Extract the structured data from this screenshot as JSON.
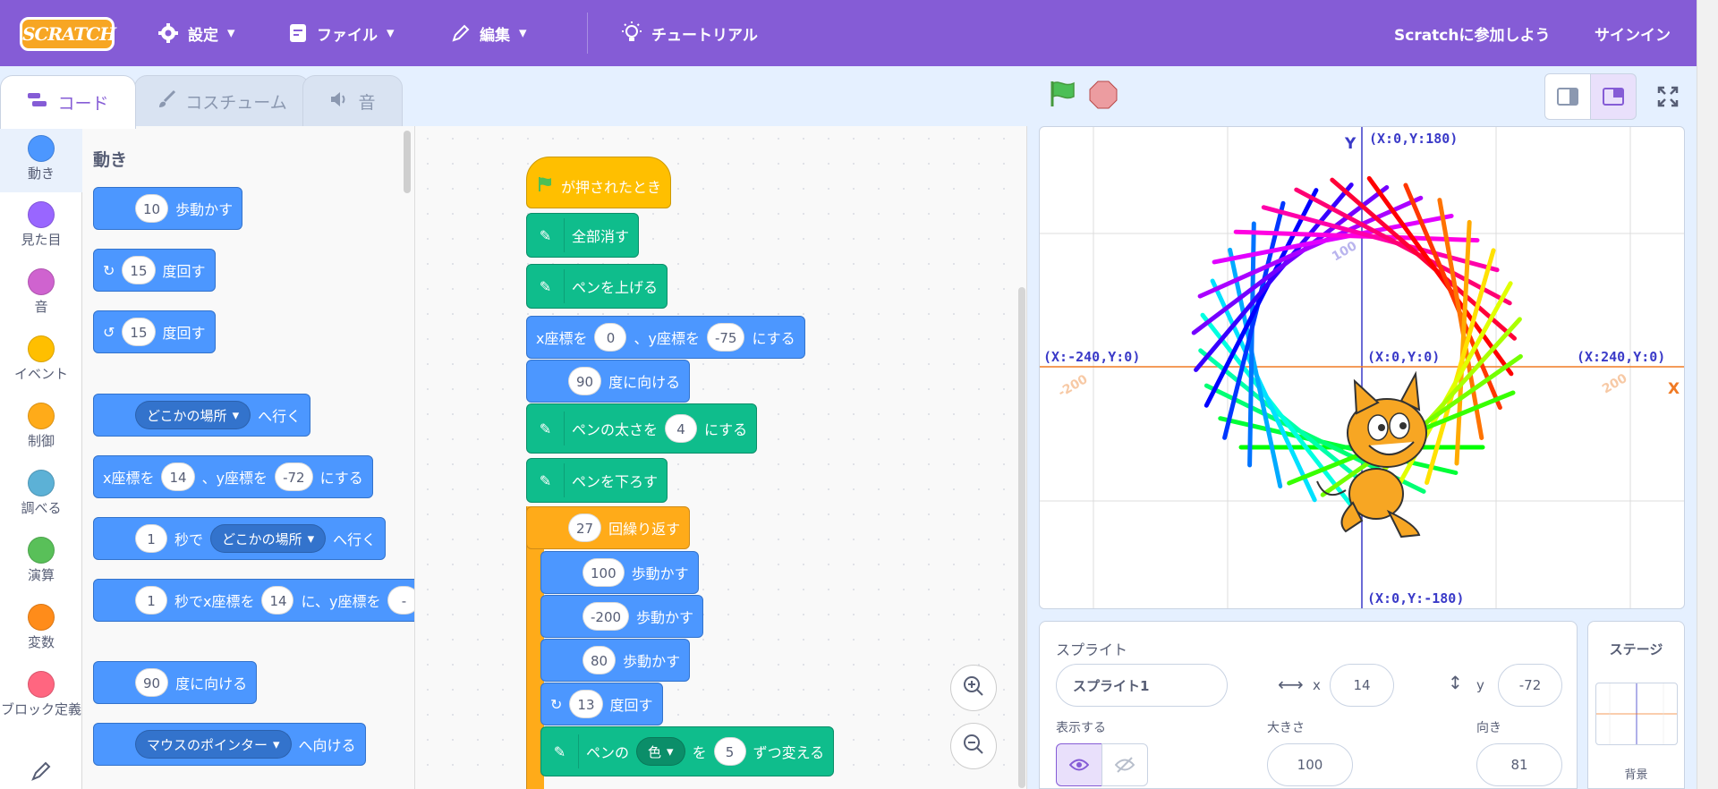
{
  "menubar": {
    "logo": "SCRATCH",
    "settings": "設定",
    "file": "ファイル",
    "edit": "編集",
    "tutorial": "チュートリアル",
    "join": "Scratchに参加しよう",
    "signin": "サインイン"
  },
  "tabs": {
    "code": "コード",
    "costume": "コスチューム",
    "sound": "音"
  },
  "categories": [
    {
      "label": "動き",
      "color": "#4c97ff"
    },
    {
      "label": "見た目",
      "color": "#9966ff"
    },
    {
      "label": "音",
      "color": "#cf63cf"
    },
    {
      "label": "イベント",
      "color": "#ffbf00"
    },
    {
      "label": "制御",
      "color": "#ffab19"
    },
    {
      "label": "調べる",
      "color": "#5cb1d6"
    },
    {
      "label": "演算",
      "color": "#59c059"
    },
    {
      "label": "変数",
      "color": "#ff8c1a"
    },
    {
      "label": "ブロック定義",
      "color": "#ff6680"
    }
  ],
  "palette": {
    "heading": "動き",
    "move": {
      "value": "10",
      "text": "歩動かす"
    },
    "turn_right": {
      "value": "15",
      "text": "度回す"
    },
    "turn_left": {
      "value": "15",
      "text": "度回す"
    },
    "goto": {
      "drop": "どこかの場所",
      "text": "へ行く"
    },
    "goto_xy": {
      "a": "x座標を",
      "x": "14",
      "b": "、y座標を",
      "y": "-72",
      "c": "にする"
    },
    "glide": {
      "value": "1",
      "a": "秒で",
      "drop": "どこかの場所",
      "b": "へ行く"
    },
    "glide_xy": {
      "value": "1",
      "a": "秒でx座標を",
      "x": "14",
      "b": "に、y座標を",
      "y": "-"
    },
    "point": {
      "value": "90",
      "text": "度に向ける"
    },
    "point_towards": {
      "drop": "マウスのポインター",
      "text": "へ向ける"
    }
  },
  "script": {
    "flag": "が押されたとき",
    "clear": "全部消す",
    "pen_up": "ペンを上げる",
    "goto": {
      "a": "x座標を",
      "x": "0",
      "b": "、y座標を",
      "y": "-75",
      "c": "にする"
    },
    "point": {
      "value": "90",
      "text": "度に向ける"
    },
    "pen_size": {
      "a": "ペンの太さを",
      "value": "4",
      "b": "にする"
    },
    "pen_down": "ペンを下ろす",
    "repeat": {
      "value": "27",
      "text": "回繰り返す"
    },
    "move1": {
      "value": "100",
      "text": "歩動かす"
    },
    "move2": {
      "value": "-200",
      "text": "歩動かす"
    },
    "move3": {
      "value": "80",
      "text": "歩動かす"
    },
    "turn": {
      "value": "13",
      "text": "度回す"
    },
    "pen_color": {
      "a": "ペンの",
      "drop": "色",
      "b": "を",
      "value": "5",
      "c": "ずつ変える"
    }
  },
  "stage": {
    "labels": {
      "top": "(X:0,Y:180)",
      "bottom": "(X:0,Y:-180)",
      "left": "(X:-240,Y:0)",
      "right": "(X:240,Y:0)",
      "center": "(X:0,Y:0)",
      "y_axis": "Y",
      "x_axis": "X",
      "tick100": "100",
      "tick200": "200",
      "tickm200": "-200"
    }
  },
  "sprite_info": {
    "title": "スプライト",
    "name": "スプライト1",
    "x_label": "x",
    "x": "14",
    "y_label": "y",
    "y": "-72",
    "show_label": "表示する",
    "size_label": "大きさ",
    "size": "100",
    "direction_label": "向き",
    "direction": "81"
  },
  "stage_pane": {
    "title": "ステージ",
    "backdrop_label": "背景"
  },
  "colors": {
    "menubar": "#855cd6",
    "motion": "#4c97ff",
    "pen": "#0fbd8c",
    "control": "#ffab19",
    "event": "#ffbf00"
  }
}
